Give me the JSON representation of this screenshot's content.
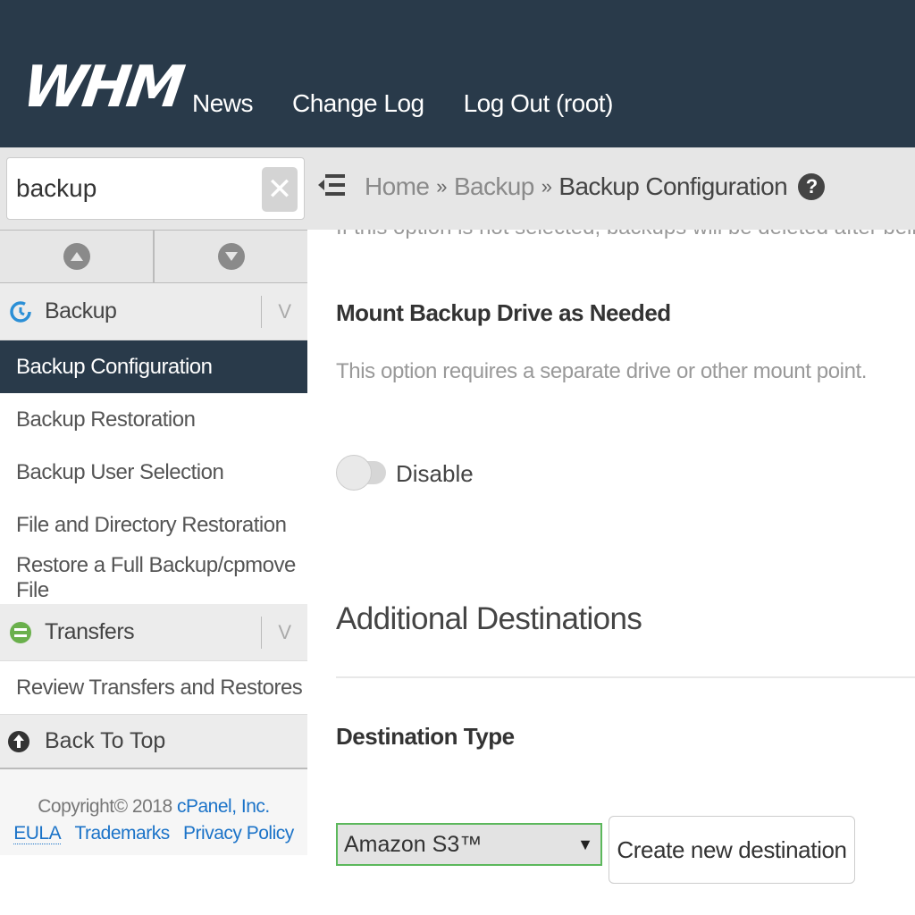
{
  "header": {
    "logo": "WHM",
    "nav": [
      "News",
      "Change Log",
      "Log Out (root)"
    ]
  },
  "sidebar": {
    "search_value": "backup",
    "categories": [
      {
        "label": "Backup",
        "icon": "backup-clock-icon",
        "items": [
          "Backup Configuration",
          "Backup Restoration",
          "Backup User Selection",
          "File and Directory Restoration",
          "Restore a Full Backup/cpmove File"
        ],
        "active_item": "Backup Configuration"
      },
      {
        "label": "Transfers",
        "icon": "transfers-icon",
        "items": [
          "Review Transfers and Restores"
        ]
      }
    ],
    "back_to_top": "Back To Top",
    "footer": {
      "copyright": "Copyright© 2018",
      "company": "cPanel, Inc.",
      "links": [
        "EULA",
        "Trademarks",
        "Privacy Policy"
      ]
    }
  },
  "breadcrumb": {
    "items": [
      "Home",
      "Backup"
    ],
    "current": "Backup Configuration",
    "separator": "»"
  },
  "main": {
    "cut_off_text": "If this option is not selected, backups will be deleted after being",
    "mount_title": "Mount Backup Drive as Needed",
    "mount_desc": "This option requires a separate drive or other mount point.",
    "toggle_label": "Disable",
    "section_title": "Additional Destinations",
    "destination_type_label": "Destination Type",
    "destination_selected": "Amazon S3™",
    "create_button": "Create new destination"
  },
  "colors": {
    "header_bg": "#293a4a",
    "active_item_bg": "#293a4a",
    "link": "#1b73c8",
    "select_border": "#5cb85c",
    "backup_icon": "#2b8fd6",
    "transfers_icon": "#6ab04c"
  }
}
